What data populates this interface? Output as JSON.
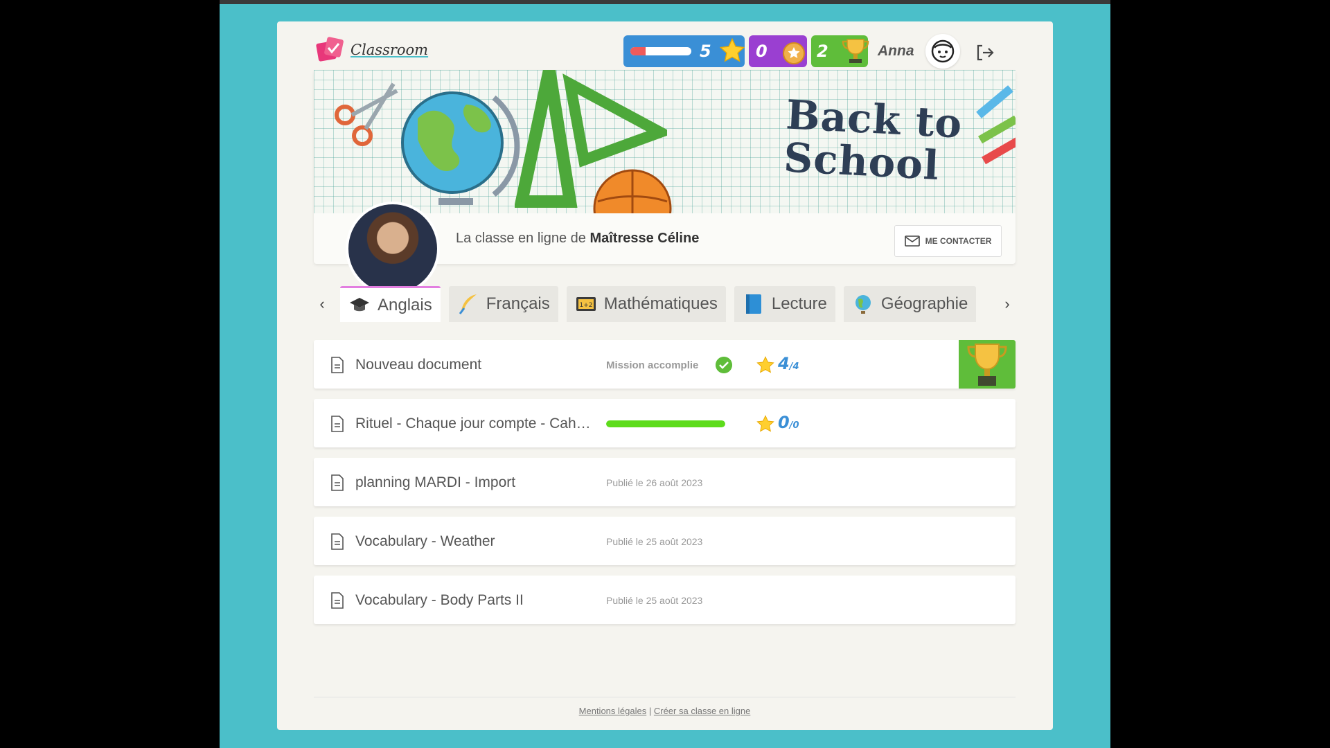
{
  "app": {
    "logo_text": "Classroom"
  },
  "header": {
    "xp_progress": 0.25,
    "level": "5",
    "medals": "0",
    "trophies": "2",
    "username": "Anna"
  },
  "profile": {
    "banner_title_line1": "Back to",
    "banner_title_line2": "School",
    "text_prefix": "La classe en ligne de ",
    "teacher_name": "Maîtresse Céline",
    "contact_label": "ME CONTACTER"
  },
  "tabs": [
    {
      "label": "Anglais",
      "icon": "graduation-cap-icon",
      "active": true
    },
    {
      "label": "Français",
      "icon": "quill-icon",
      "active": false
    },
    {
      "label": "Mathématiques",
      "icon": "calculator-icon",
      "active": false
    },
    {
      "label": "Lecture",
      "icon": "book-icon",
      "active": false
    },
    {
      "label": "Géographie",
      "icon": "globe-icon",
      "active": false
    }
  ],
  "documents": [
    {
      "title": "Nouveau document",
      "status": "Mission accomplie",
      "score": "4",
      "score_max": "/4"
    },
    {
      "title": "Rituel - Chaque jour compte - Cahier",
      "progress": 1.0,
      "score": "0",
      "score_max": "/0"
    },
    {
      "title": "planning MARDI - Import",
      "date": "Publié le 26 août 2023"
    },
    {
      "title": "Vocabulary - Weather",
      "date": "Publié le 25 août 2023"
    },
    {
      "title": "Vocabulary - Body Parts II",
      "date": "Publié le 25 août 2023"
    }
  ],
  "footer": {
    "legal": "Mentions légales",
    "separator": "|",
    "create": "Créer sa classe en ligne"
  },
  "colors": {
    "background": "#4bbfc9",
    "xp": "#3a8fd6",
    "medals": "#9a3fd1",
    "trophies": "#5fbd3a",
    "active_tab": "#e27ee0"
  }
}
